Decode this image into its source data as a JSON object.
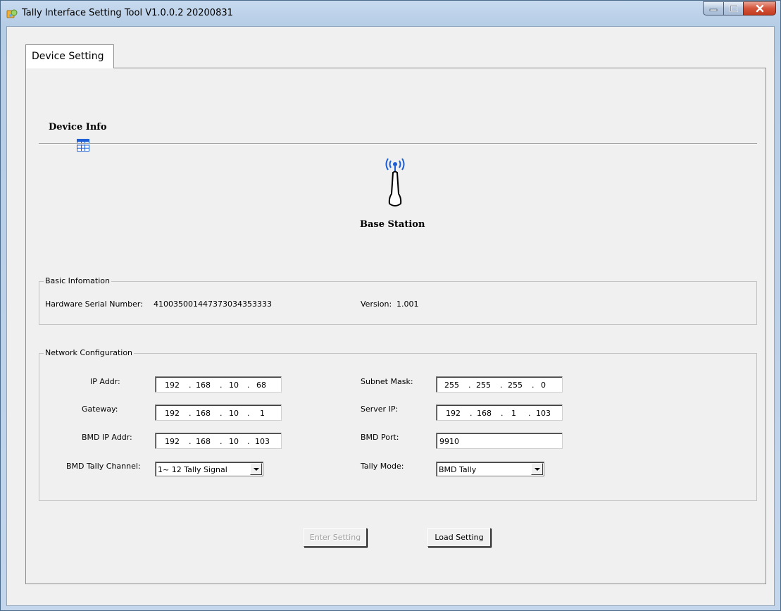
{
  "window": {
    "title": "Tally Interface Setting Tool V1.0.0.2 20200831"
  },
  "tabs": [
    {
      "label": "Device Setting",
      "selected": true
    }
  ],
  "device_info": {
    "icon": "grid-icon",
    "label": "Device Info"
  },
  "base_station": {
    "icon": "antenna-icon",
    "label": "Base Station"
  },
  "basic_info": {
    "title": "Basic Infomation",
    "serial_label": "Hardware Serial Number:",
    "serial_value": "410035001447373034353333",
    "version_label": "Version:",
    "version_value": "1.001"
  },
  "network": {
    "title": "Network Configuration",
    "ip_addr": {
      "label": "IP Addr:",
      "octets": [
        "192",
        "168",
        "10",
        "68"
      ]
    },
    "subnet_mask": {
      "label": "Subnet Mask:",
      "octets": [
        "255",
        "255",
        "255",
        "0"
      ]
    },
    "gateway": {
      "label": "Gateway:",
      "octets": [
        "192",
        "168",
        "10",
        "1"
      ]
    },
    "server_ip": {
      "label": "Server IP:",
      "octets": [
        "192",
        "168",
        "1",
        "103"
      ]
    },
    "bmd_ip_addr": {
      "label": "BMD IP Addr:",
      "octets": [
        "192",
        "168",
        "10",
        "103"
      ]
    },
    "bmd_port": {
      "label": "BMD Port:",
      "value": "9910"
    },
    "bmd_tally_channel": {
      "label": "BMD Tally Channel:",
      "selected": "1~ 12 Tally Signal"
    },
    "tally_mode": {
      "label": "Tally Mode:",
      "selected": "BMD Tally"
    }
  },
  "buttons": {
    "enter_setting": "Enter Setting",
    "load_setting": "Load Setting"
  },
  "colors": {
    "accent_blue": "#1e5fd6",
    "disabled_text": "#a0a0a0",
    "close_red": "#c23b20"
  }
}
